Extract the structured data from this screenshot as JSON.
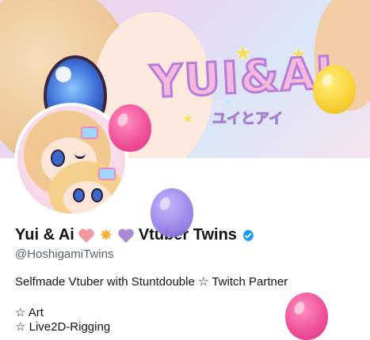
{
  "banner": {
    "logo_text": "YUI&AI",
    "logo_subtext": "ユイとアイ"
  },
  "profile": {
    "display_name": "Yui & Ai",
    "name_emojis": [
      "pink-heart-icon",
      "glowing-star-icon",
      "purple-heart-icon"
    ],
    "name_suffix": "Vtuber Twins",
    "verified": true,
    "handle": "@HoshigamiTwins",
    "bio": "Selfmade Vtuber with Stuntdouble ☆ Twitch Partner",
    "bio_items": [
      "☆ Art",
      "☆ Live2D-Rigging"
    ]
  },
  "colors": {
    "verified_blue": "#1d9bf0",
    "balloon_pink": "#f0529a",
    "balloon_purple": "#9b84e8",
    "balloon_yellow": "#f9d23a"
  }
}
